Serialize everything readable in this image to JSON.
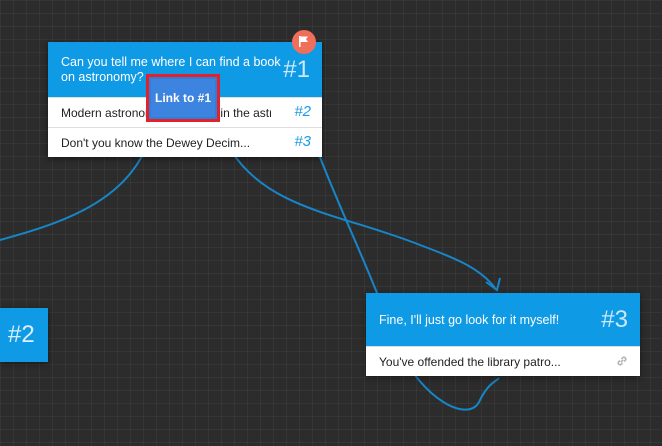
{
  "nodes": {
    "n1": {
      "text": "Can you tell me where I can find a book on astronomy?",
      "number": "#1",
      "responses": [
        {
          "text": "Modern astronomy books are in the astronomy section.",
          "link": "#2"
        },
        {
          "text": "Don't you know the Dewey Decim...",
          "link": "#3"
        }
      ]
    },
    "n2": {
      "number": "#2"
    },
    "n3": {
      "text": "Fine, I'll just go look for it myself!",
      "number": "#3",
      "responses": [
        {
          "text": "You've offended the library patro..."
        }
      ]
    }
  },
  "tooltip": {
    "label": "Link to #1"
  },
  "icons": {
    "flag": "flag-icon",
    "link": "chain-link-icon"
  },
  "colors": {
    "node_header": "#0f9ae6",
    "connector": "#1786c7",
    "flag_badge": "#f06f5a",
    "highlight": "#e4202a"
  }
}
